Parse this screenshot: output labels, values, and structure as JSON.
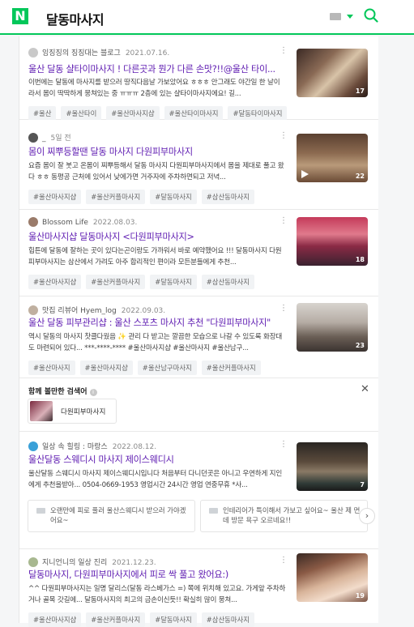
{
  "header": {
    "logo": "N",
    "query": "달동마사지"
  },
  "posts": [
    {
      "author": "잉징징의 징징대는 블로그",
      "date": "2021.07.16.",
      "title": "울산 달동 샬타이마사지 ! 다른곳과 뭔가 다른 손맛?!!@울산 타이...",
      "desc": "이번에는 달동에 마사지를 받으러 땅직다음날 가보았어요 ㅎㅎㅎ 안그래도 야간일 한 날이라서 몸이 딱딱하게 뭉쳐있는 중 ㅠㅠㅠ 2층에 있는 샬타이마사지에요! 길...",
      "tags": [
        "#울산",
        "#울산타이",
        "#울산마사지샵",
        "#울산타이마사지",
        "#달동타이마사지"
      ],
      "count": "17",
      "avatar_color": "#c9c9c9",
      "thumb": "linear-gradient(135deg, #3b2a25 0%, #8a6a55 35%, #d8c3a8 55%, #6a4a3a 80%, #2a1c18 100%)"
    },
    {
      "author": "_",
      "date": "5일 전",
      "title": "몸이 찌뿌등할땐 달동 마사지 다원피부마사지",
      "desc": "요즘 몸이 잘 붓고 온몸이 찌뿌등해서 달동 마사지 다원피부마사지에서 몸을 제대로 풀고 왔다 ㅎㅎ 동평공 근처에 있어서 낮에가면 거주자에 주차하면되고 저녁...",
      "tags": [
        "#울산마사지샵",
        "#울산커플마사지",
        "#달동마사지",
        "#삼산동마사지"
      ],
      "count": "22",
      "avatar_color": "#555555",
      "thumb": "linear-gradient(180deg, #5a4030 0%, #8c6a50 40%, #b99a7a 65%, #6a4a35 100%)"
    },
    {
      "author": "Blossom Life",
      "date": "2022.08.03.",
      "title": "울산마사지샵 달동마사지 <다원피부마사지>",
      "desc": "힙튼에 달동에 잘하는 곳이 있다는곤이랑도 가까워서 바로 예약했어요 !!! 달동마사지 다원피부마사지는 삼산에서 가려도 아주 합리적인 편이라 모든분들에게 추천...",
      "tags": [
        "#울산마사지샵",
        "#울산커플마사지",
        "#달동마사지",
        "#삼산동마사지"
      ],
      "count": "18",
      "avatar_color": "#9a7b6a",
      "thumb": "linear-gradient(180deg, #c43a5a 0%, #e07a8c 35%, #8a2a45 60%, #3a2230 100%)"
    },
    {
      "author": "맛집 리뷰어 Hyem_log",
      "date": "2022.09.03.",
      "title": "울산 달동 피부관리샵 : 울산 스포츠 마사지 추천 \"다원피부마사지\"",
      "desc": "역시 달동의 마사지 찻클다웠음 ✨ 관리 다 받고는 깔끔한 모습으로 나갈 수 있도록 화장대도 마련되어 있다... ***-****-**** #울산마사지샵 #울산마사지 #울산남구...",
      "tags": [
        "#울산마사지",
        "#울산마사지샵",
        "#울산남구마사지",
        "#울산커플마사지"
      ],
      "count": "23",
      "avatar_color": "#c0b0a0",
      "thumb": "linear-gradient(180deg, #d8d4cf 0%, #b5aca4 40%, #6a5e55 70%, #3a3330 100%)"
    }
  ],
  "related": {
    "title": "함께 볼만한 검색어",
    "info": "i",
    "close": "✕",
    "item": "다원피부마사지"
  },
  "post5": {
    "author": "일상 속 힐링 : 마랑스",
    "date": "2022.08.12.",
    "title": "울산달동 스웨디시 마사지 제이스웨디시",
    "desc": "울산달동 스웨디시 마사지 제이스웨디시입니다 처음부터 다니던곳은 아니고 우연하게 지인에게 추천을받아... 0504-0669-1953 영업시간 24시간 영업 연중무휴 *사...",
    "count": "7",
    "avatar_color": "#3aa0d8",
    "thumb": "linear-gradient(180deg, #2a2622 0%, #5a4a3c 40%, #8a7a66 60%, #2f3a36 85%, #1a1a1a 100%)",
    "snippets": [
      "오랜만에 피로 풀러 울산스웨디시 받으러 가야겠어요~",
      "인테리어가 특이해서 가보고 싶어요~ 울산 제 먼데 방문 욕구 오르네요!!"
    ],
    "arrow": "›"
  },
  "post6": {
    "author": "지니언니의 일상 진리",
    "date": "2021.12.23.",
    "title": "달동마사지, 다원피부마사지에서 피로 싹 풀고 왔어요:)",
    "desc": "^^ 다원피부마사지는 일명 달리스(달동 라스베가스 =) 쪽에 위치해 있고요. 가게앞 주차하거나 골목 갓길에... 달동마사지의 최고의 금손이신듯!! 확실히 많이 뭉쳐...",
    "tags": [
      "#울산마사지샵",
      "#울산커플마사지",
      "#달동마사지",
      "#삼산동마사지"
    ],
    "count": "19",
    "avatar_color": "#a8b890",
    "thumb": "linear-gradient(160deg, #3a2a24 0%, #8a5a45 30%, #d8b49a 55%, #f2dccb 75%, #7a5242 100%)"
  }
}
